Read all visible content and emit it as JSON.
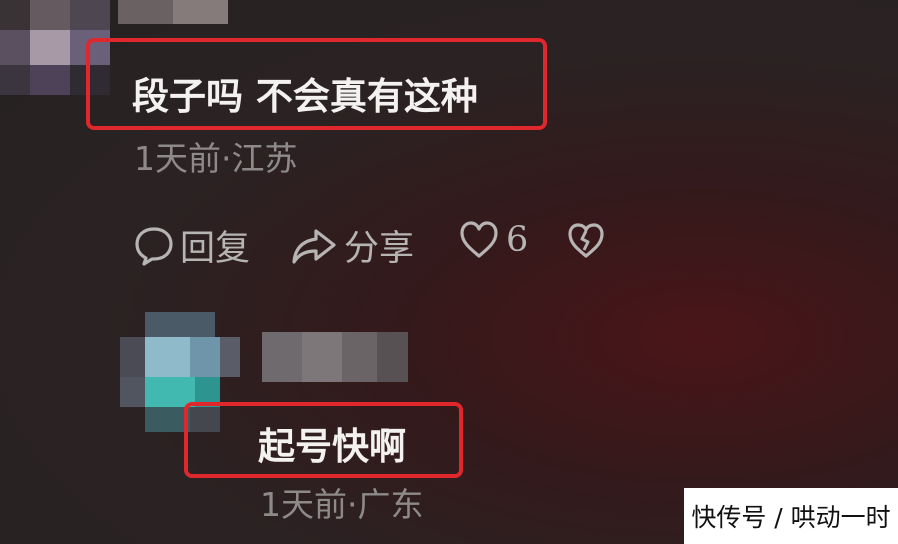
{
  "comment1": {
    "text": "段子吗 不会真有这种",
    "meta": "1天前·江苏"
  },
  "actions": {
    "reply_label": "回复",
    "share_label": "分享",
    "like_count": "6"
  },
  "comment2": {
    "text": "起号快啊",
    "meta": "1天前·广东"
  },
  "watermark": {
    "text": "快传号 / 哄动一时"
  },
  "colors": {
    "highlight": "#e0272b",
    "meta_text": "#8e8a8a"
  },
  "icons": [
    "comment-bubble-icon",
    "share-arrow-icon",
    "heart-icon",
    "broken-heart-icon"
  ]
}
